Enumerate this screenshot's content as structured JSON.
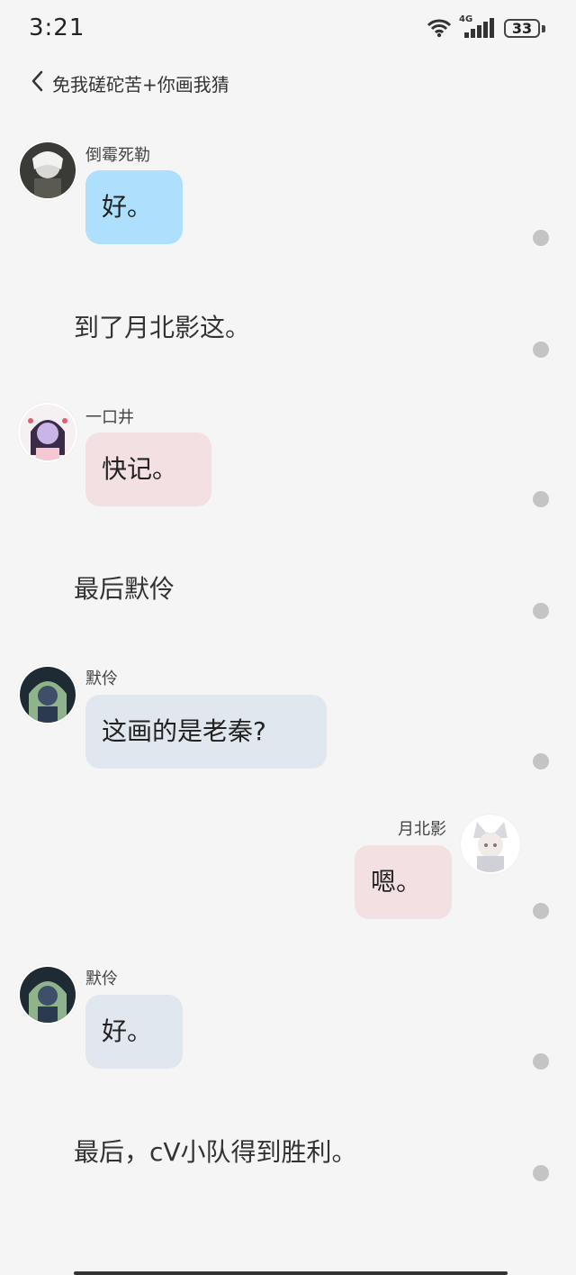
{
  "status_bar": {
    "time": "3:21",
    "network": "4G",
    "battery": "33"
  },
  "header": {
    "title": "免我磋砣苦+你画我猜"
  },
  "messages": [
    {
      "sender": "倒霉死勒",
      "text": "好。"
    },
    {
      "narration": "到了月北影这。"
    },
    {
      "sender": "一口井",
      "text": "快记。"
    },
    {
      "narration": "最后默伶"
    },
    {
      "sender": "默伶",
      "text": "这画的是老秦?"
    },
    {
      "sender": "月北影",
      "text": "嗯。"
    },
    {
      "sender": "默伶",
      "text": "好。"
    },
    {
      "narration": "最后，cV小队得到胜利。"
    }
  ]
}
